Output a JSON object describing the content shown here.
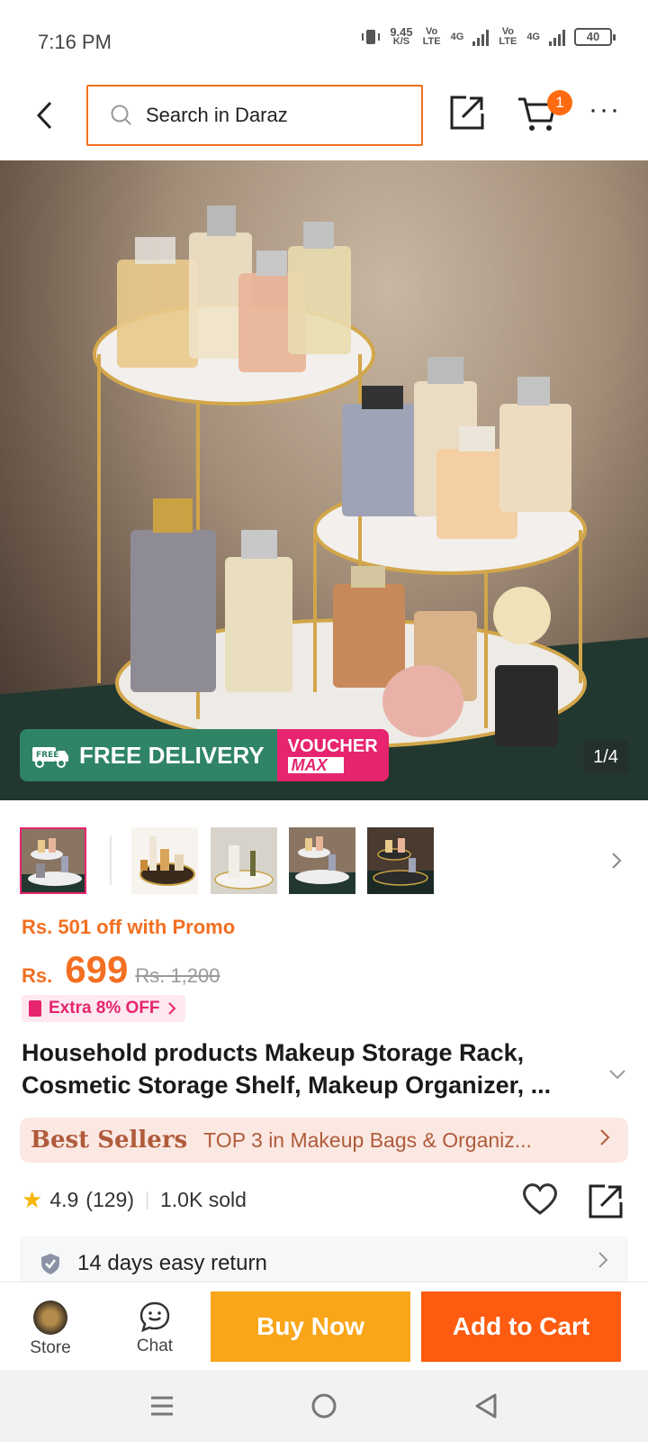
{
  "status_bar": {
    "time": "7:16 PM",
    "net_speed_value": "9.45",
    "net_speed_unit": "K/S",
    "volte_1": "Vo LTE",
    "network_1": "4G",
    "volte_2": "Vo LTE",
    "network_2": "4G",
    "battery": "40"
  },
  "header": {
    "search_placeholder": "Search in Daraz",
    "cart_count": "1",
    "more": "···"
  },
  "hero": {
    "free_delivery_badge": "FREE",
    "free_delivery_label": "FREE DELIVERY",
    "voucher_label": "VOUCHER",
    "voucher_sub": "MAX",
    "image_counter": "1/4"
  },
  "product": {
    "promo_text": "Rs. 501 off with Promo",
    "currency": "Rs.",
    "price": "699",
    "original_price": "Rs. 1,200",
    "extra_off": "Extra 8% OFF",
    "title": "Household products Makeup Storage Rack, Cosmetic Storage Shelf, Makeup Organizer, ...",
    "bestseller_tag": "Best Sellers",
    "bestseller_text": "TOP 3 in Makeup Bags & Organiz...",
    "rating": "4.9",
    "rating_count": "(129)",
    "sold": "1.0K sold",
    "return_policy": "14 days easy return"
  },
  "bottom_bar": {
    "store_label": "Store",
    "chat_label": "Chat",
    "buy_now_label": "Buy Now",
    "add_to_cart_label": "Add to Cart"
  },
  "colors": {
    "accent_orange": "#f36f21",
    "buy_now": "#f9a61a",
    "add_to_cart": "#fd5b0f",
    "free_delivery_green": "#2f8466",
    "voucher_pink": "#e7246f"
  }
}
